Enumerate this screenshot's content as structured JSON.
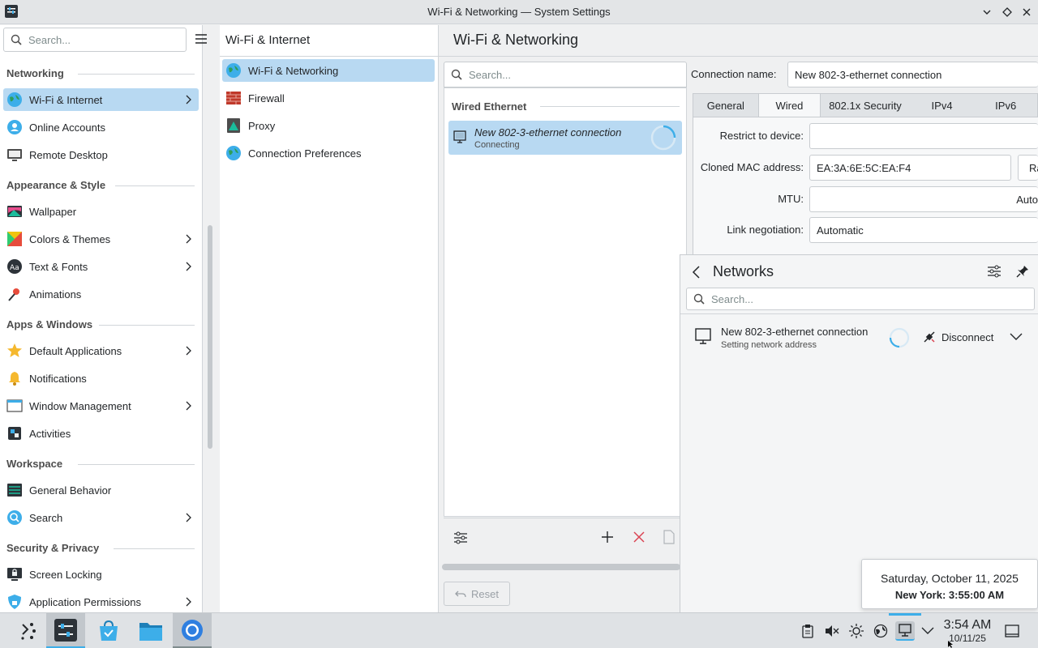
{
  "window": {
    "title": "Wi-Fi & Networking — System Settings"
  },
  "sidebar": {
    "search_placeholder": "Search...",
    "sections": [
      {
        "title": "Networking",
        "items": [
          {
            "label": "Wi-Fi & Internet",
            "icon": "globe-icon",
            "selected": true,
            "chevron": true
          },
          {
            "label": "Online Accounts",
            "icon": "online-accounts-icon",
            "chevron": false
          },
          {
            "label": "Remote Desktop",
            "icon": "remote-desktop-icon",
            "chevron": false
          }
        ]
      },
      {
        "title": "Appearance & Style",
        "items": [
          {
            "label": "Wallpaper",
            "icon": "wallpaper-icon",
            "chevron": false
          },
          {
            "label": "Colors & Themes",
            "icon": "colors-icon",
            "chevron": true
          },
          {
            "label": "Text & Fonts",
            "icon": "fonts-icon",
            "chevron": true
          },
          {
            "label": "Animations",
            "icon": "animations-icon",
            "chevron": false
          }
        ]
      },
      {
        "title": "Apps & Windows",
        "items": [
          {
            "label": "Default Applications",
            "icon": "star-icon",
            "chevron": true
          },
          {
            "label": "Notifications",
            "icon": "bell-icon",
            "chevron": false
          },
          {
            "label": "Window Management",
            "icon": "window-icon",
            "chevron": true
          },
          {
            "label": "Activities",
            "icon": "activities-icon",
            "chevron": false
          }
        ]
      },
      {
        "title": "Workspace",
        "items": [
          {
            "label": "General Behavior",
            "icon": "general-behavior-icon",
            "chevron": false
          },
          {
            "label": "Search",
            "icon": "search-app-icon",
            "chevron": true
          }
        ]
      },
      {
        "title": "Security & Privacy",
        "items": [
          {
            "label": "Screen Locking",
            "icon": "screen-lock-icon",
            "chevron": false
          },
          {
            "label": "Application Permissions",
            "icon": "shield-icon",
            "chevron": true
          }
        ]
      }
    ]
  },
  "col2": {
    "title": "Wi-Fi & Internet",
    "items": [
      {
        "label": "Wi-Fi & Networking",
        "icon": "globe-icon",
        "selected": true
      },
      {
        "label": "Firewall",
        "icon": "firewall-icon"
      },
      {
        "label": "Proxy",
        "icon": "proxy-icon"
      },
      {
        "label": "Connection Preferences",
        "icon": "globe-icon"
      }
    ]
  },
  "main": {
    "title": "Wi-Fi & Networking",
    "search_placeholder": "Search...",
    "group_label": "Wired Ethernet",
    "connection": {
      "name": "New 802-3-ethernet connection",
      "status": "Connecting"
    },
    "reset_label": "Reset",
    "form": {
      "connection_name_label": "Connection name:",
      "connection_name_value": "New 802-3-ethernet connection",
      "tabs": [
        "General",
        "Wired",
        "802.1x Security",
        "IPv4",
        "IPv6"
      ],
      "active_tab": "Wired",
      "restrict_label": "Restrict to device:",
      "restrict_value": "",
      "mac_label": "Cloned MAC address:",
      "mac_value": "EA:3A:6E:5C:EA:F4",
      "mac_button": "Ra",
      "mtu_label": "MTU:",
      "mtu_value": "Auto",
      "link_label": "Link negotiation:",
      "link_value": "Automatic"
    }
  },
  "networks_popup": {
    "title": "Networks",
    "search_placeholder": "Search...",
    "connection_name": "New 802-3-ethernet connection",
    "connection_status": "Setting network address",
    "disconnect_label": "Disconnect"
  },
  "clock_popup": {
    "date": "Saturday, October 11, 2025",
    "city": "New York:",
    "time": "3:55:00 AM"
  },
  "taskbar": {
    "time": "3:54 AM",
    "date": "10/11/25"
  },
  "colors": {
    "accent": "#3daee9",
    "selection": "#b8d9f2"
  }
}
